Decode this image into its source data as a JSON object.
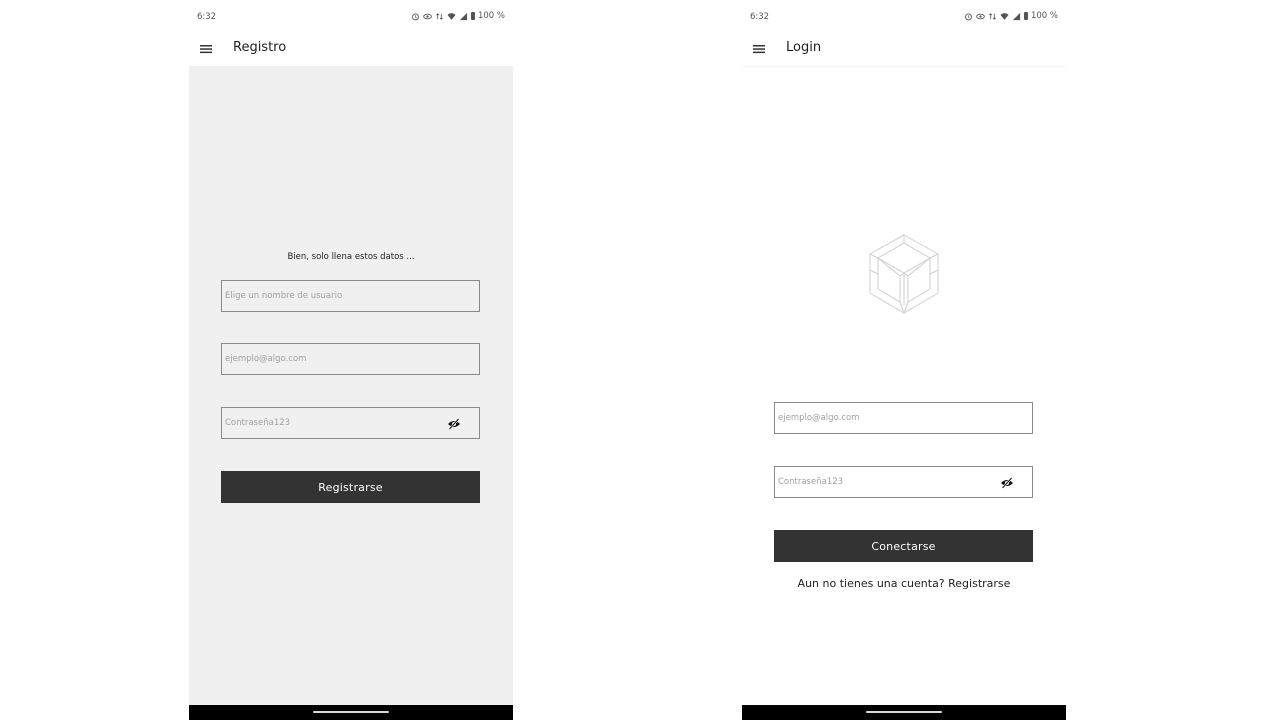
{
  "register_screen": {
    "status": {
      "time": "6:32",
      "battery": "100 %"
    },
    "app_bar": {
      "title": "Registro"
    },
    "intro_text": "Bien, solo llena estos datos ...",
    "username_field": {
      "placeholder": "Elige un nombre de usuario"
    },
    "email_field": {
      "placeholder": "ejemplo@algo.com"
    },
    "password_field": {
      "placeholder": "Contraseña123"
    },
    "submit_label": "Registrarse"
  },
  "login_screen": {
    "status": {
      "time": "6:32",
      "battery": "100 %"
    },
    "app_bar": {
      "title": "Login"
    },
    "email_field": {
      "placeholder": "ejemplo@algo.com"
    },
    "password_field": {
      "placeholder": "Contraseña123"
    },
    "submit_label": "Conectarse",
    "register_prompt": "Aun no tienes una cuenta? Registrarse"
  },
  "icons": {
    "menu": "hamburger-menu-icon",
    "toggle_password": "eye-slash-icon",
    "logo": "cube-logo",
    "status": [
      "alarm-icon",
      "eye-icon",
      "data-icon",
      "wifi-icon",
      "signal-icon",
      "battery-icon"
    ]
  },
  "colors": {
    "register_background": "#f0f0f0",
    "login_background": "#ffffff",
    "button": "#333333",
    "button_text": "#ffffff",
    "input_border": "#8a8a8a",
    "placeholder": "#a0a0a0"
  }
}
